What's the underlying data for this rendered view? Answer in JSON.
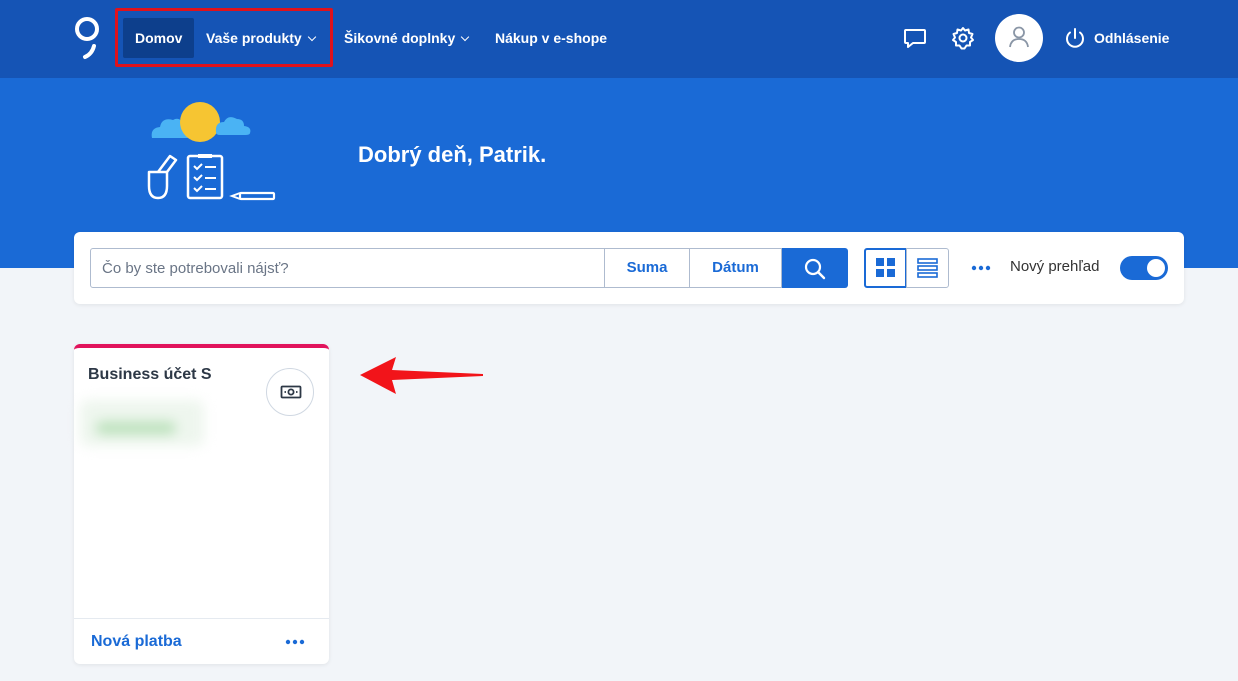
{
  "nav": {
    "logo": "brand-logo",
    "items": [
      {
        "label": "Domov",
        "active": true
      },
      {
        "label": "Vaše produkty",
        "dropdown": true
      },
      {
        "label": "Šikovné doplnky",
        "dropdown": true
      },
      {
        "label": "Nákup v e-shope",
        "dropdown": false
      }
    ],
    "icons": [
      "chat-icon",
      "gear-icon",
      "user-icon"
    ],
    "logout_label": "Odhlásenie"
  },
  "hero": {
    "greeting": "Dobrý deň,  Patrik."
  },
  "toolbar": {
    "search_placeholder": "Čo by ste potrebovali nájsť?",
    "sum_label": "Suma",
    "date_label": "Dátum",
    "toggle_label": "Nový prehľad",
    "toggle_on": true,
    "view_mode": "grid"
  },
  "card": {
    "title": "Business účet S",
    "action_label": "Nová platba"
  },
  "colors": {
    "topbar": "#1554b5",
    "hero": "#1a6ad6",
    "accent": "#1a6ad6",
    "card_top_border": "#e1135c",
    "annotation": "#e0121c"
  }
}
